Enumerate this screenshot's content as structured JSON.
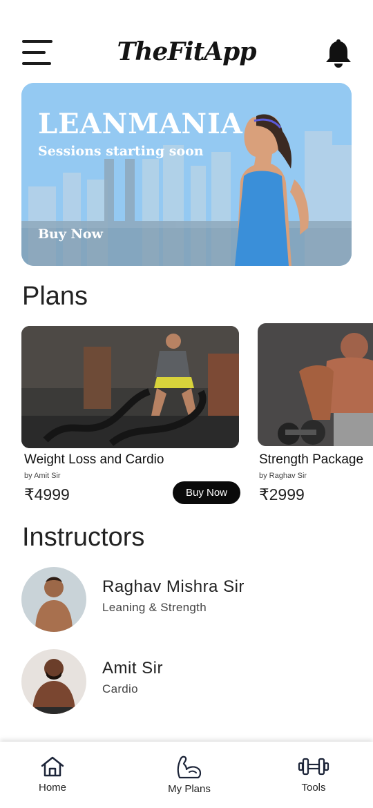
{
  "header": {
    "app_title": "TheFitApp",
    "menu_icon": "hamburger-menu-icon",
    "bell_icon": "bell-icon"
  },
  "banner": {
    "title": "LEANMANIA",
    "subtitle": "Sessions starting soon",
    "cta": "Buy Now"
  },
  "plans": {
    "heading": "Plans",
    "items": [
      {
        "name": "Weight Loss and Cardio",
        "by": "by Amit Sir",
        "price": "₹4999",
        "cta": "Buy Now"
      },
      {
        "name": "Strength Package",
        "by": "by Raghav Sir",
        "price": "₹2999"
      }
    ]
  },
  "instructors": {
    "heading": "Instructors",
    "items": [
      {
        "name": "Raghav Mishra Sir",
        "specialty": "Leaning & Strength"
      },
      {
        "name": "Amit Sir",
        "specialty": "Cardio"
      }
    ]
  },
  "bottom_nav": {
    "items": [
      {
        "label": "Home",
        "icon": "home-icon"
      },
      {
        "label": "My Plans",
        "icon": "flexed-arm-icon"
      },
      {
        "label": "Tools",
        "icon": "dumbbell-icon"
      }
    ]
  },
  "colors": {
    "primary_text": "#1a1a1a",
    "button_bg": "#0a0a0a",
    "banner_bg": "#8ec8f6"
  }
}
